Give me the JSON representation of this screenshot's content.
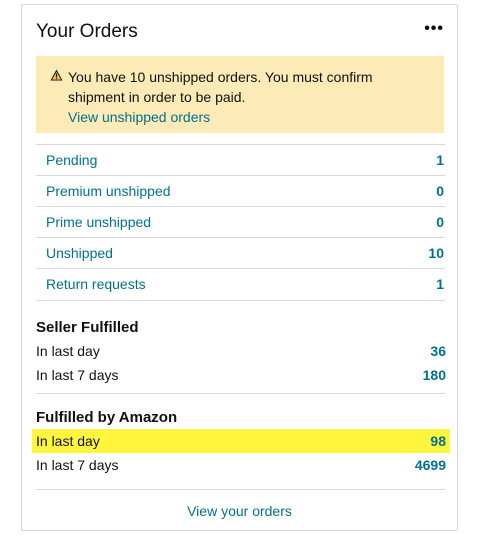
{
  "card": {
    "title": "Your Orders",
    "more_label": "•••"
  },
  "alert": {
    "message": "You have 10 unshipped orders. You must confirm shipment in order to be paid.",
    "link": "View unshipped orders",
    "icon": "warning-icon"
  },
  "order_rows": [
    {
      "label": "Pending",
      "value": "1"
    },
    {
      "label": "Premium unshipped",
      "value": "0"
    },
    {
      "label": "Prime unshipped",
      "value": "0"
    },
    {
      "label": "Unshipped",
      "value": "10"
    },
    {
      "label": "Return requests",
      "value": "1"
    }
  ],
  "seller_fulfilled": {
    "title": "Seller Fulfilled",
    "last_day_label": "In last day",
    "last_day_value": "36",
    "last_7_label": "In last 7 days",
    "last_7_value": "180"
  },
  "fba": {
    "title": "Fulfilled by Amazon",
    "last_day_label": "In last day",
    "last_day_value": "98",
    "last_7_label": "In last 7 days",
    "last_7_value": "4699"
  },
  "footer": {
    "link": "View your orders"
  },
  "colors": {
    "link": "#00718f",
    "alert_bg": "#fcebb6",
    "highlight": "#fff53c"
  }
}
